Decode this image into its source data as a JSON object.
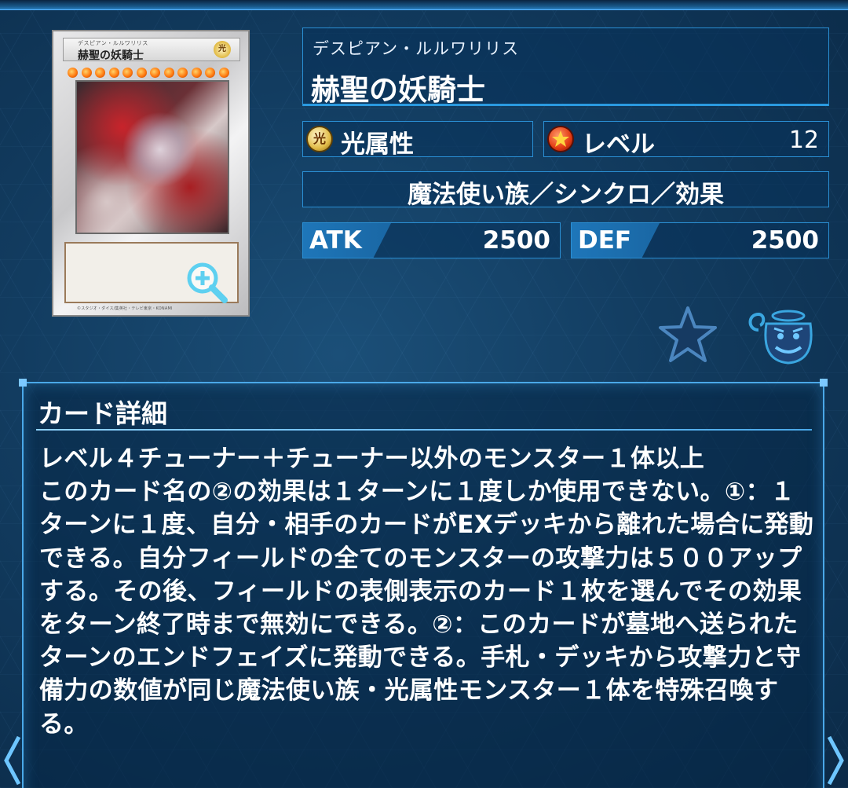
{
  "card_image": {
    "ruby": "デスピアン・ルルワリリス",
    "name": "赫聖の妖騎士",
    "attribute_glyph": "光",
    "star_count": 12,
    "copyright": "©スタジオ・ダイス/集英社・テレビ東京・KONAMI"
  },
  "card": {
    "ruby": "デスピアン・ルルワリリス",
    "name": "赫聖の妖騎士",
    "attribute_icon": "光",
    "attribute": "光属性",
    "level_label": "レベル",
    "level_value": "12",
    "type": "魔法使い族／シンクロ／効果",
    "atk_label": "ATK",
    "atk_value": "2500",
    "def_label": "DEF",
    "def_value": "2500"
  },
  "actions": {
    "favorite_icon": "star-icon",
    "pot_icon": "pot-of-greed-icon",
    "magnify_icon": "magnify-plus-icon"
  },
  "detail": {
    "title": "カード詳細",
    "text": "レベル４チューナー＋チューナー以外のモンスター１体以上\nこのカード名の②の効果は１ターンに１度しか使用できない。①：１ターンに１度、自分・相手のカードがEXデッキから離れた場合に発動できる。自分フィールドの全てのモンスターの攻撃力は５００アップする。その後、フィールドの表側表示のカード１枚を選んでその効果をターン終了時まで無効にできる。②：このカードが墓地へ送られたターンのエンドフェイズに発動できる。手札・デッキから攻撃力と守備力の数値が同じ魔法使い族・光属性モンスター１体を特殊召喚する。"
  },
  "colors": {
    "panel_border": "#2a8fd4",
    "accent": "#4aa8e8",
    "background": "#123c60"
  }
}
